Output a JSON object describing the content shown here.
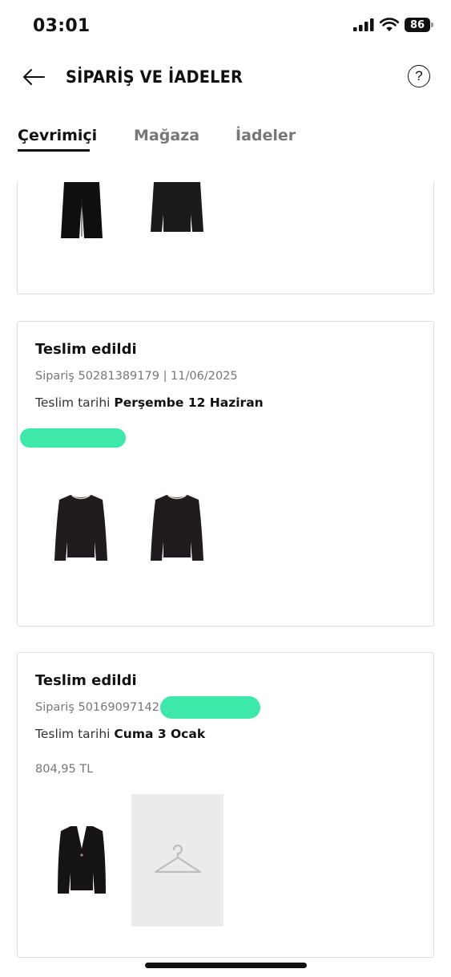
{
  "status_bar": {
    "time": "03:01",
    "battery": "86"
  },
  "header": {
    "title": "SİPARİŞ VE İADELER",
    "help_label": "?"
  },
  "tabs": [
    {
      "label": "Çevrimiçi"
    },
    {
      "label": "Mağaza"
    },
    {
      "label": "İadeler"
    }
  ],
  "orders": [
    {
      "status": "Teslim edildi",
      "order_prefix": "Sipariş 50281389179 | 11/06/2025",
      "delivery_label": "Teslim tarihi",
      "delivery_date": "Perşembe 12 Haziran"
    },
    {
      "status": "Teslim edildi",
      "order_prefix": "Sipariş 50169097142 |",
      "delivery_label": "Teslim tarihi",
      "delivery_date": "Cuma 3 Ocak",
      "price": "804,95 TL"
    }
  ],
  "colors": {
    "accent": "#111111",
    "redaction": "#3de8a8",
    "card_border": "#dedede"
  }
}
